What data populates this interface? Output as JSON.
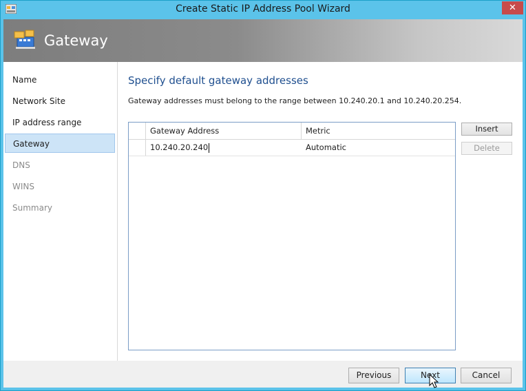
{
  "window": {
    "title": "Create Static IP Address Pool Wizard",
    "close_glyph": "✕"
  },
  "banner": {
    "title": "Gateway"
  },
  "nav": {
    "items": [
      {
        "label": "Name",
        "state": "normal"
      },
      {
        "label": "Network Site",
        "state": "normal"
      },
      {
        "label": "IP address range",
        "state": "normal"
      },
      {
        "label": "Gateway",
        "state": "selected"
      },
      {
        "label": "DNS",
        "state": "disabled"
      },
      {
        "label": "WINS",
        "state": "disabled"
      },
      {
        "label": "Summary",
        "state": "disabled"
      }
    ]
  },
  "main": {
    "title": "Specify default gateway addresses",
    "description": "Gateway addresses must belong to the range between 10.240.20.1 and 10.240.20.254."
  },
  "grid": {
    "columns": [
      "Gateway Address",
      "Metric"
    ],
    "rows": [
      {
        "gateway_address": "10.240.20.240",
        "metric": "Automatic"
      }
    ]
  },
  "side_buttons": {
    "insert": "Insert",
    "delete": "Delete"
  },
  "footer": {
    "previous": "Previous",
    "next": "Next",
    "cancel": "Cancel"
  },
  "colors": {
    "titlebar": "#5bc3ea",
    "selected_nav": "#cde4f7",
    "heading": "#1f4f8f",
    "close_button": "#c74b4b"
  }
}
